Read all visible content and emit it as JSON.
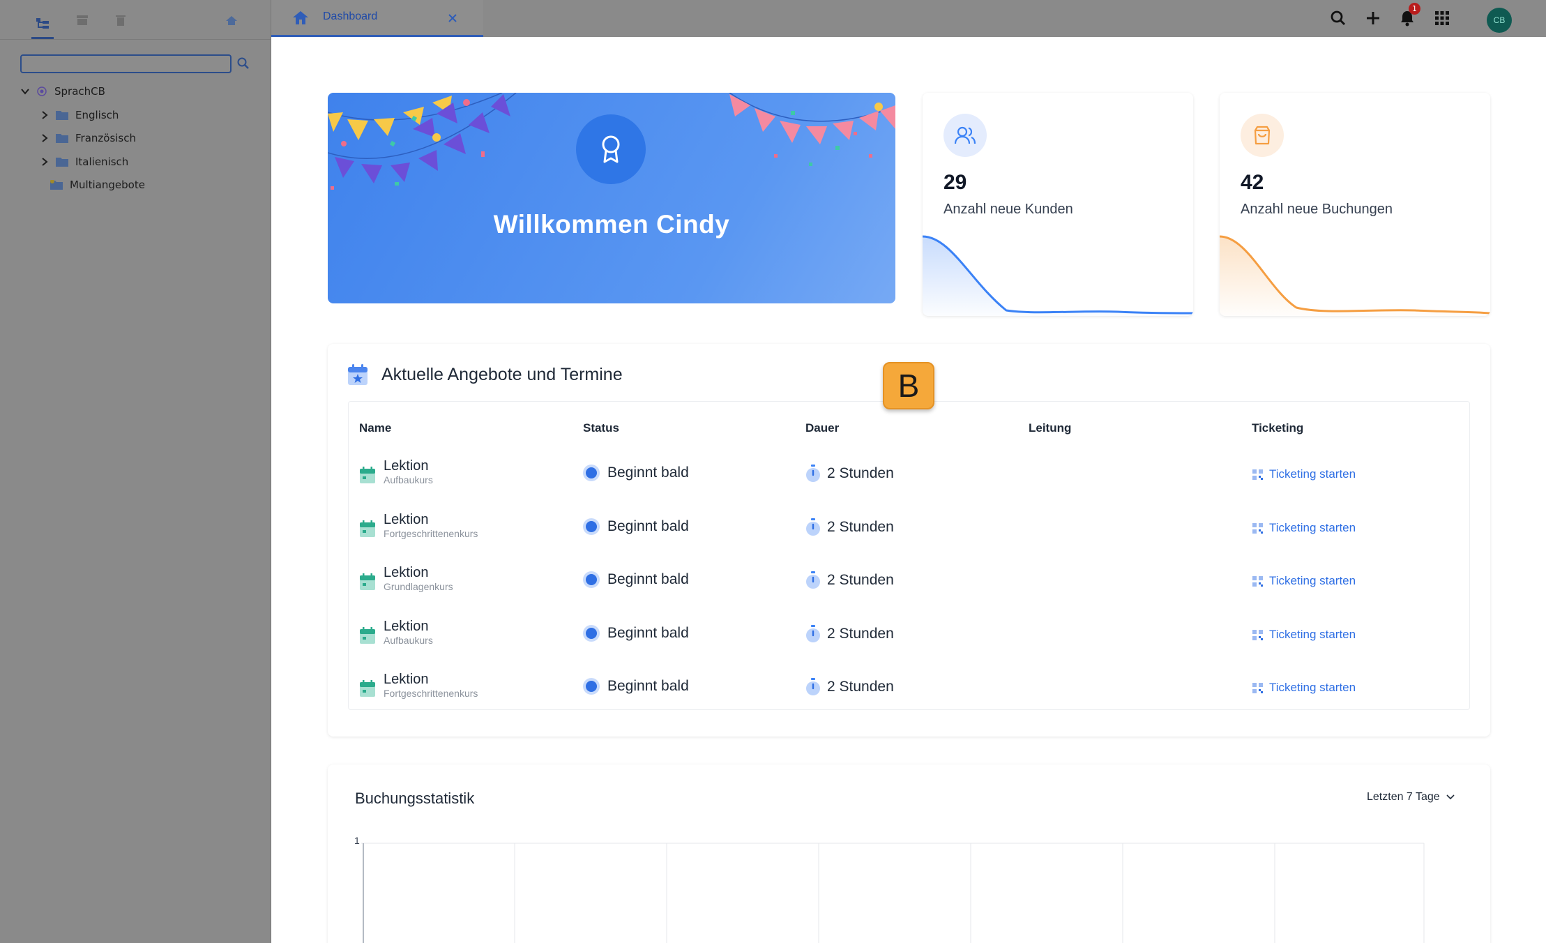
{
  "sidebar": {
    "search_placeholder": "",
    "tree": {
      "root": "SprachCB",
      "items": [
        {
          "label": "Englisch"
        },
        {
          "label": "Französisch"
        },
        {
          "label": "Italienisch"
        },
        {
          "label": "Multiangebote"
        }
      ]
    }
  },
  "tabs": [
    {
      "label": "Dashboard",
      "icon": "home-icon"
    }
  ],
  "topbar": {
    "notification_count": "1",
    "avatar_initials": "CB"
  },
  "welcome": {
    "title": "Willkommen Cindy",
    "icon": "award-icon"
  },
  "stats": [
    {
      "value": "29",
      "label": "Anzahl neue Kunden",
      "color": "#3b82f6",
      "icon": "users-icon"
    },
    {
      "value": "42",
      "label": "Anzahl neue Buchungen",
      "color": "#f59e42",
      "icon": "shopping-bag-icon"
    }
  ],
  "offers": {
    "title": "Aktuelle Angebote und Termine",
    "columns": [
      "Name",
      "Status",
      "Dauer",
      "Leitung",
      "Ticketing"
    ],
    "rows": [
      {
        "name": "Lektion",
        "sub": "Aufbaukurs",
        "status": "Beginnt bald",
        "duration": "2 Stunden",
        "lead": "",
        "ticketing": "Ticketing starten"
      },
      {
        "name": "Lektion",
        "sub": "Fortgeschrittenenkurs",
        "status": "Beginnt bald",
        "duration": "2 Stunden",
        "lead": "",
        "ticketing": "Ticketing starten"
      },
      {
        "name": "Lektion",
        "sub": "Grundlagenkurs",
        "status": "Beginnt bald",
        "duration": "2 Stunden",
        "lead": "",
        "ticketing": "Ticketing starten"
      },
      {
        "name": "Lektion",
        "sub": "Aufbaukurs",
        "status": "Beginnt bald",
        "duration": "2 Stunden",
        "lead": "",
        "ticketing": "Ticketing starten"
      },
      {
        "name": "Lektion",
        "sub": "Fortgeschrittenenkurs",
        "status": "Beginnt bald",
        "duration": "2 Stunden",
        "lead": "",
        "ticketing": "Ticketing starten"
      }
    ]
  },
  "marker": "B",
  "booking_stats": {
    "title": "Buchungsstatistik",
    "range": "Letzten 7 Tage",
    "y_tick": "1"
  },
  "colors": {
    "accent": "#2f6fe4",
    "sidebar_bg": "#8a8a8a",
    "badge": "#b91c1c"
  }
}
